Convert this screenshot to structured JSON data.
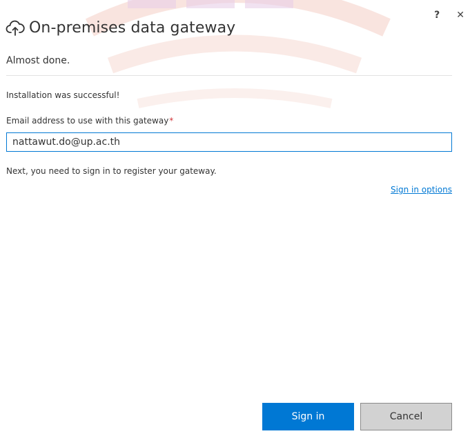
{
  "window": {
    "help_label": "?",
    "close_label": "✕"
  },
  "header": {
    "title": "On-premises data gateway",
    "subtitle": "Almost done."
  },
  "content": {
    "status_text": "Installation was successful!",
    "email_label": "Email address to use with this gateway",
    "required_marker": "*",
    "email_value": "nattawut.do@up.ac.th",
    "next_text": "Next, you need to sign in to register your gateway.",
    "sign_in_options_label": "Sign in options"
  },
  "footer": {
    "sign_in_label": "Sign in",
    "cancel_label": "Cancel"
  },
  "colors": {
    "accent": "#0078d4",
    "required": "#d13438",
    "secondary_button": "#d2d2d2"
  }
}
